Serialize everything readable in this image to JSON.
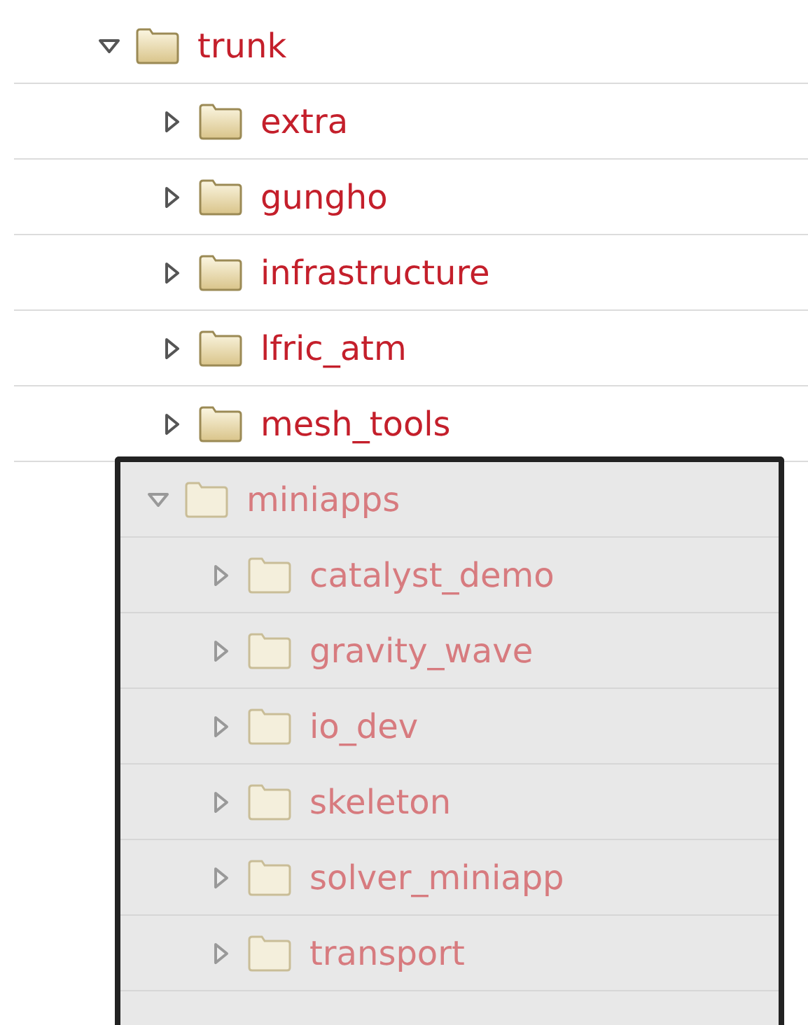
{
  "tree": [
    {
      "name": "trunk",
      "expanded": true,
      "children": [
        {
          "name": "extra",
          "expanded": false
        },
        {
          "name": "gungho",
          "expanded": false
        },
        {
          "name": "infrastructure",
          "expanded": false
        },
        {
          "name": "lfric_atm",
          "expanded": false
        },
        {
          "name": "mesh_tools",
          "expanded": false
        },
        {
          "name": "miniapps",
          "expanded": true,
          "highlighted": true,
          "children": [
            {
              "name": "catalyst_demo",
              "expanded": false
            },
            {
              "name": "gravity_wave",
              "expanded": false
            },
            {
              "name": "io_dev",
              "expanded": false
            },
            {
              "name": "skeleton",
              "expanded": false
            },
            {
              "name": "solver_miniapp",
              "expanded": false
            },
            {
              "name": "transport",
              "expanded": false
            }
          ]
        }
      ]
    }
  ]
}
